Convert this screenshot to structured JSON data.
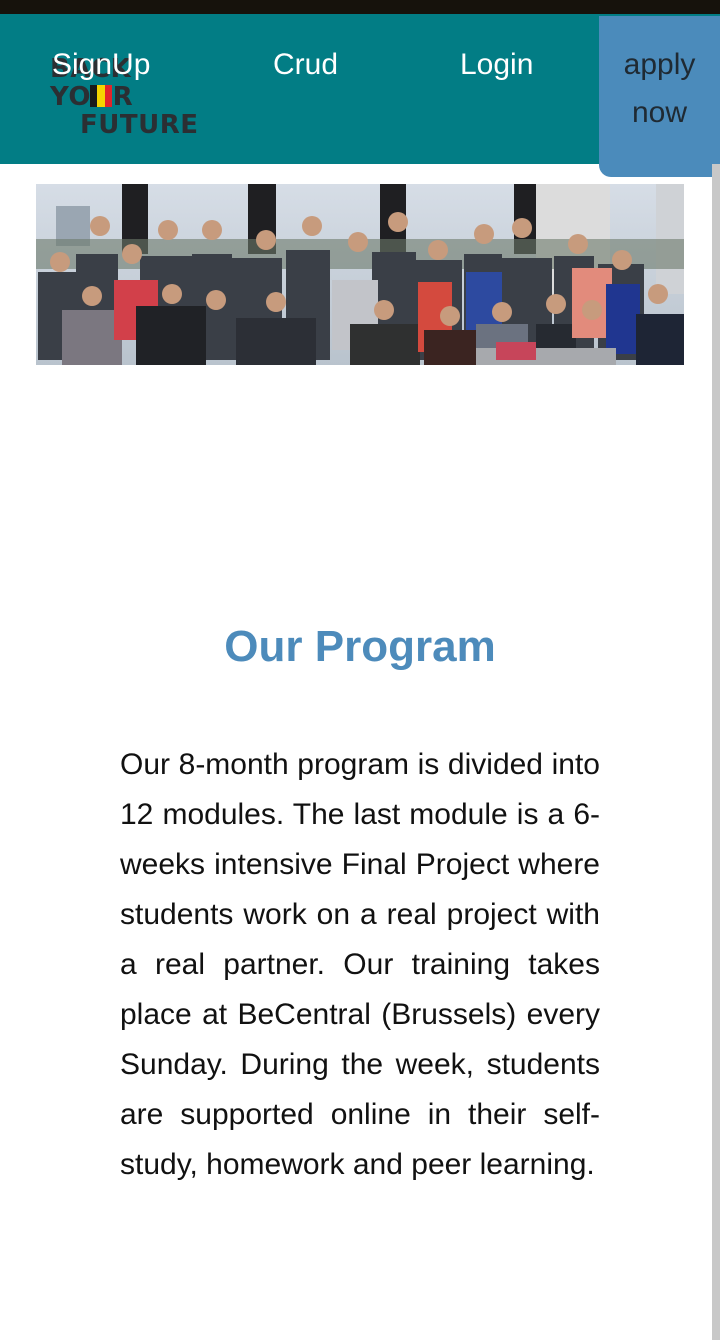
{
  "navbar": {
    "logo": {
      "line1": "BACK",
      "line2": "YOUR",
      "line3": "FUTURE"
    },
    "links": [
      {
        "label": "SignUp"
      },
      {
        "label": "Crud"
      },
      {
        "label": "Login"
      }
    ],
    "apply_label": "apply now",
    "background_color": "#027d85",
    "apply_color": "#4b8bbb"
  },
  "hero": {
    "alt": "Group photo of students"
  },
  "program": {
    "title": "Our Program",
    "title_color": "#4d8bbb",
    "description": "Our 8-month program is divided into 12 modules. The last module is a 6-weeks intensive Final Project where students work on a real project with a real partner. Our training takes place at BeCentral (Brussels) every Sunday. During the week, students are supported online in their self-study, homework and peer learning."
  }
}
